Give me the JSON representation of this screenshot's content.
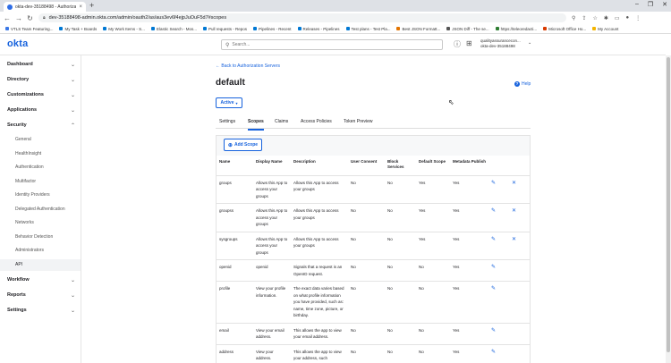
{
  "browser": {
    "tab_title": "okta-dev-35188498 - Authorizat...",
    "url": "dev-35188498-admin.okta.com/admin/oauth2/as/aus3ev6f4ejpJuOuF5d7#scopes",
    "bookmarks": [
      {
        "label": "VTLS Team Featuring...",
        "color": "#3b78e7"
      },
      {
        "label": "My Task + Boards",
        "color": "#0078d4"
      },
      {
        "label": "My Work Items - S...",
        "color": "#0078d4"
      },
      {
        "label": "Elastic Search - Mos...",
        "color": "#0078d4"
      },
      {
        "label": "Pull requests - Repos",
        "color": "#0078d4"
      },
      {
        "label": "Pipelines - Recent",
        "color": "#0078d4"
      },
      {
        "label": "Releases - Pipelines",
        "color": "#0078d4"
      },
      {
        "label": "Test plans - Test Pla...",
        "color": "#0078d4"
      },
      {
        "label": "Best JSON Formatt...",
        "color": "#e37400"
      },
      {
        "label": "JSON Diff - The se...",
        "color": "#555555"
      },
      {
        "label": "https://teleoredacti...",
        "color": "#2e7d32"
      },
      {
        "label": "Microsoft Office Ho...",
        "color": "#d83b01"
      },
      {
        "label": "My Account",
        "color": "#f4b400"
      }
    ]
  },
  "header": {
    "logo": "okta",
    "search_placeholder": "Search...",
    "account_line1": "qualityassurancecon...",
    "account_line2": "okta-dev-35188498"
  },
  "sidebar": {
    "sections": [
      {
        "label": "Dashboard",
        "expanded": false
      },
      {
        "label": "Directory",
        "expanded": false
      },
      {
        "label": "Customizations",
        "expanded": false
      },
      {
        "label": "Applications",
        "expanded": false
      },
      {
        "label": "Security",
        "expanded": true
      }
    ],
    "security_items": [
      "General",
      "HealthInsight",
      "Authentication",
      "Multifactor",
      "Identity Providers",
      "Delegated Authentication",
      "Networks",
      "Behavior Detection",
      "Administrators",
      "API"
    ],
    "active_item": "API",
    "bottom_sections": [
      {
        "label": "Workflow"
      },
      {
        "label": "Reports"
      },
      {
        "label": "Settings"
      }
    ]
  },
  "main": {
    "back_link": "← Back to Authorization Servers",
    "title": "default",
    "help": "Help",
    "status": "Active",
    "tabs": [
      "Settings",
      "Scopes",
      "Claims",
      "Access Policies",
      "Token Preview"
    ],
    "active_tab": "Scopes",
    "add_scope": "Add Scope"
  },
  "table": {
    "headers": [
      "Name",
      "Display Name",
      "Description",
      "User Consent",
      "Block Services",
      "Default Scope",
      "Metadata Publish"
    ],
    "rows": [
      {
        "name": "groups",
        "display": "Allows this App to access your groups",
        "desc": "Allows this App to access your groups",
        "consent": "No",
        "block": "No",
        "default": "Yes",
        "meta": "Yes",
        "deletable": true
      },
      {
        "name": "groupss",
        "display": "Allows this App to access your groups",
        "desc": "Allows this App to access your groups",
        "consent": "No",
        "block": "No",
        "default": "Yes",
        "meta": "Yes",
        "deletable": true
      },
      {
        "name": "sysgroups",
        "display": "Allows this App to access your groups",
        "desc": "Allows this App to access your groups",
        "consent": "No",
        "block": "No",
        "default": "Yes",
        "meta": "Yes",
        "deletable": true
      },
      {
        "name": "openid",
        "display": "openid",
        "desc": "Signals that a request is an OpenID request.",
        "consent": "No",
        "block": "No",
        "default": "No",
        "meta": "Yes",
        "deletable": false
      },
      {
        "name": "profile",
        "display": "View your profile information.",
        "desc": "The exact data varies based on what profile information you have provided, such as: name, time zone, picture, or birthday.",
        "consent": "No",
        "block": "No",
        "default": "No",
        "meta": "Yes",
        "deletable": false
      },
      {
        "name": "email",
        "display": "View your email address.",
        "desc": "This allows the app to view your email address.",
        "consent": "No",
        "block": "No",
        "default": "No",
        "meta": "Yes",
        "deletable": false
      },
      {
        "name": "address",
        "display": "View your address.",
        "desc": "This allows the app to view your address, such",
        "consent": "No",
        "block": "No",
        "default": "No",
        "meta": "Yes",
        "deletable": false
      }
    ]
  },
  "colors": {
    "accent": "#1662dd",
    "logo": "#1662dd"
  }
}
